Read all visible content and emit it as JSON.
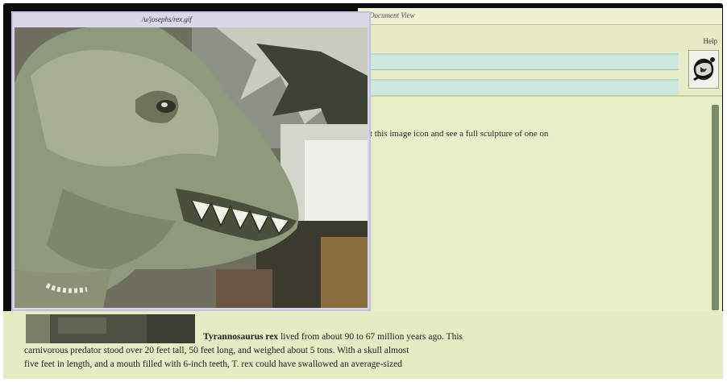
{
  "viewer": {
    "title": "/u/josephs/rex.gif",
    "image_alt": "Tyrannosaurus rex head sculpture"
  },
  "browser": {
    "title": "Document View",
    "help_label": "Help",
    "url_field_1": "",
    "url_field_2": "",
    "content_line": "et this image icon and see a full sculpture of one on"
  },
  "article": {
    "species": "Tyrannosaurus rex",
    "line1_rest": " lived from about 90 to 67 million years ago. This",
    "line2": "carnivorous predator stood over 20 feet tall, 50 feet long, and weighed about 5 tons. With a skull almost",
    "line3": "five feet in length, and a mouth filled with 6-inch teeth, T. rex could have swallowed an average-sized"
  },
  "colors": {
    "page_bg": "#e6edc6",
    "url_field": "#cbe8df",
    "viewer_frame": "#d9d5e8",
    "scroll_thumb": "#7b8a6b"
  }
}
